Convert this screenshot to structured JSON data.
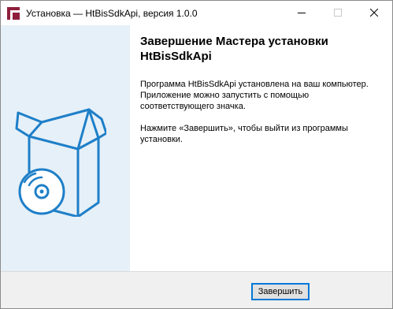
{
  "window": {
    "title": "Установка — HtBisSdkApi, версия 1.0.0",
    "controls": {
      "minimize_icon": "minimize-icon",
      "maximize_icon": "maximize-icon",
      "close_icon": "close-icon"
    }
  },
  "banner": {
    "graphic_icon": "software-box-cd-icon",
    "accent_color": "#1e7fc8",
    "background_color": "#e6f0f8"
  },
  "main": {
    "heading": "Завершение Мастера установки HtBisSdkApi",
    "paragraph1": "Программа HtBisSdkApi установлена на ваш компьютер. Приложение можно запустить с помощью соответствующего значка.",
    "paragraph2": "Нажмите «Завершить», чтобы выйти из программы установки."
  },
  "footer": {
    "finish_label": "Завершить"
  }
}
